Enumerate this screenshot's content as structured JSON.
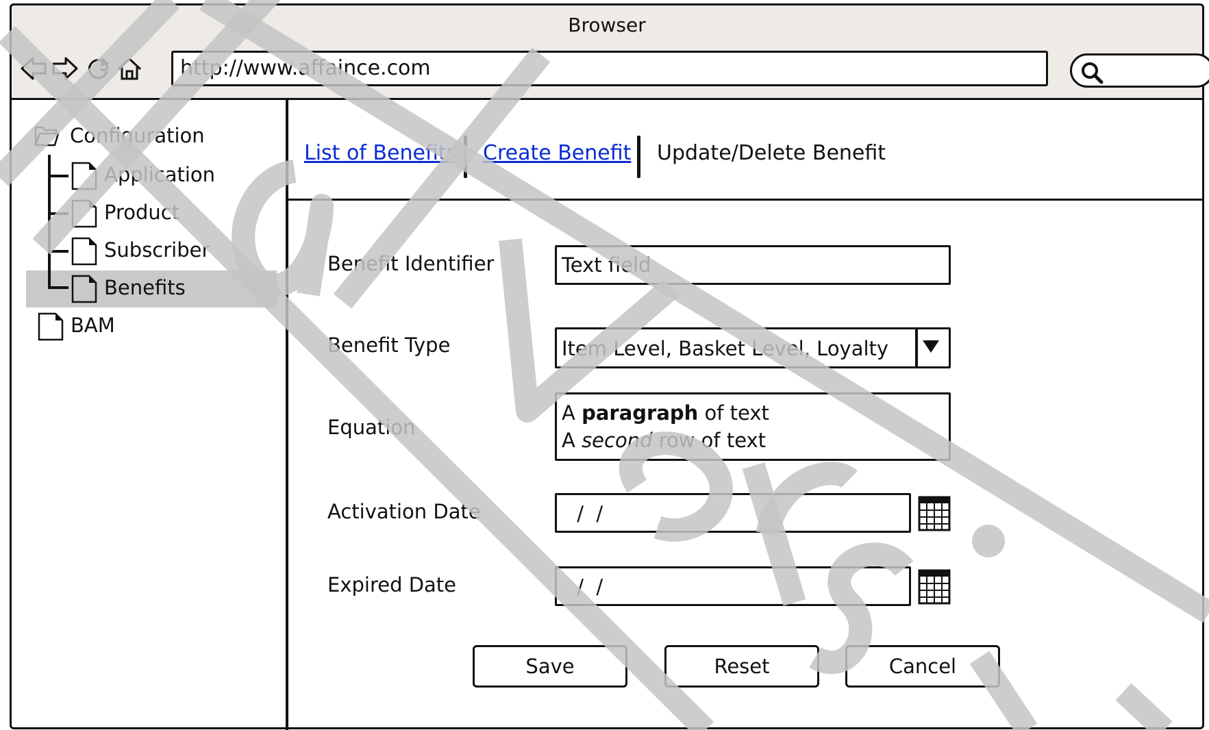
{
  "window": {
    "title": "Browser"
  },
  "browser": {
    "url": "http://www.affaince.com",
    "nav_icons": [
      "back-arrow-icon",
      "forward-arrow-icon",
      "reload-icon",
      "home-icon"
    ],
    "search_icon": "search-icon"
  },
  "sidebar": {
    "root": {
      "label": "Configuration",
      "icon": "folder-open-icon"
    },
    "items": [
      {
        "label": "Application",
        "icon": "file-icon"
      },
      {
        "label": "Product",
        "icon": "file-icon"
      },
      {
        "label": "Subscriber",
        "icon": "file-icon"
      },
      {
        "label": "Benefits",
        "icon": "file-icon",
        "selected": true
      }
    ],
    "bam": {
      "label": "BAM",
      "icon": "file-icon"
    }
  },
  "breadcrumb": {
    "link1": "List of Benefits",
    "link2": "Create Benefit",
    "current": "Update/Delete Benefit"
  },
  "form": {
    "identifier": {
      "label": "Benefit Identifier",
      "value": "Text field"
    },
    "type": {
      "label": "Benefit Type",
      "value": "Item Level, Basket Level, Loyalty"
    },
    "equation": {
      "label": "Equation",
      "line1_a": "A ",
      "line1_b": "paragraph",
      "line1_c": " of text",
      "line2_a": "A ",
      "line2_b": "second",
      "line2_c": " row of text"
    },
    "activation": {
      "label": "Activation Date",
      "value": " /  /"
    },
    "expired": {
      "label": "Expired Date",
      "value": " /  /"
    }
  },
  "buttons": {
    "save": "Save",
    "reset": "Reset",
    "cancel": "Cancel"
  },
  "colors": {
    "chrome": "#eeebe6",
    "link": "#0a2bd6",
    "selection": "#c9c9c9",
    "watermark": "#c4c4c4"
  }
}
